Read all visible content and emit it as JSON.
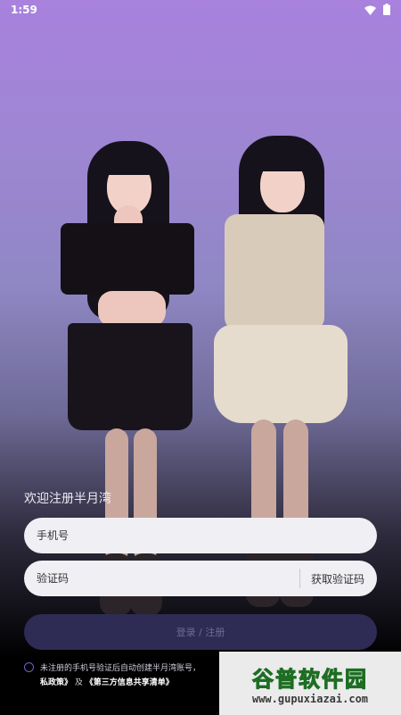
{
  "status_bar": {
    "time": "1:59",
    "icons": [
      "wifi-icon",
      "battery-icon"
    ]
  },
  "login": {
    "welcome": "欢迎注册半月湾",
    "phone_placeholder": "手机号",
    "code_placeholder": "验证码",
    "get_code_label": "获取验证码",
    "submit_label": "登录 / 注册",
    "agreement_prefix": "未注册的手机号验证后自动创建半月湾账号，",
    "agreement_link_privacy": "私政策》",
    "agreement_and": "及",
    "agreement_link_third": "《第三方信息共享清单》"
  },
  "watermark": {
    "title": "谷普软件园",
    "url": "www.gupuxiazai.com"
  },
  "colors": {
    "bg_top": "#a882dd",
    "bg_bottom": "#000000",
    "button_bg": "#2e2b55",
    "field_bg": "#f0eff3",
    "radio_border": "#6c62c8",
    "watermark_green": "#3aa236"
  }
}
